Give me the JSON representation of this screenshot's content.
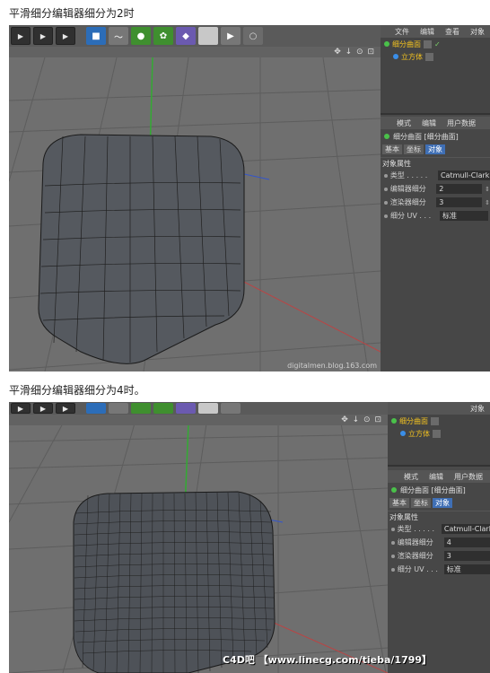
{
  "caption1": "平滑细分编辑器细分为2时",
  "caption2": "平滑细分编辑器细分为4时。",
  "object_manager": {
    "menu": [
      "文件",
      "编辑",
      "查看",
      "对象"
    ],
    "items": [
      {
        "name": "细分曲面",
        "icon": "subdivision-surface-icon"
      },
      {
        "name": "立方体",
        "icon": "cube-icon"
      }
    ]
  },
  "attribute_manager": {
    "menu": [
      "模式",
      "编辑",
      "用户数据"
    ],
    "title": "细分曲面 [细分曲面]",
    "tabs": [
      "基本",
      "坐标",
      "对象"
    ],
    "active_tab": "对象",
    "section": "对象属性",
    "type_label": "类型 . . . . .",
    "type_value": "Catmull-Clark",
    "editor_label": "编辑器细分",
    "renderer_label": "渲染器细分",
    "renderer_value": "3",
    "uv_label": "细分 UV . . .",
    "uv_value": "标准"
  },
  "shot1": {
    "editor_subdivision": "2"
  },
  "shot2": {
    "editor_subdivision": "4"
  },
  "viewport_nav": "✥ ↓ ⊙ ⊡",
  "watermark1": "digitalmen.blog.163.com",
  "watermark2": "C4D吧 【www.linecg.com/tieba/1799】",
  "icons": [
    "film-icon",
    "cube-icon",
    "spline-icon",
    "nurbs-icon",
    "generator-icon",
    "deformer-icon",
    "floor-icon",
    "camera-icon",
    "light-icon"
  ]
}
